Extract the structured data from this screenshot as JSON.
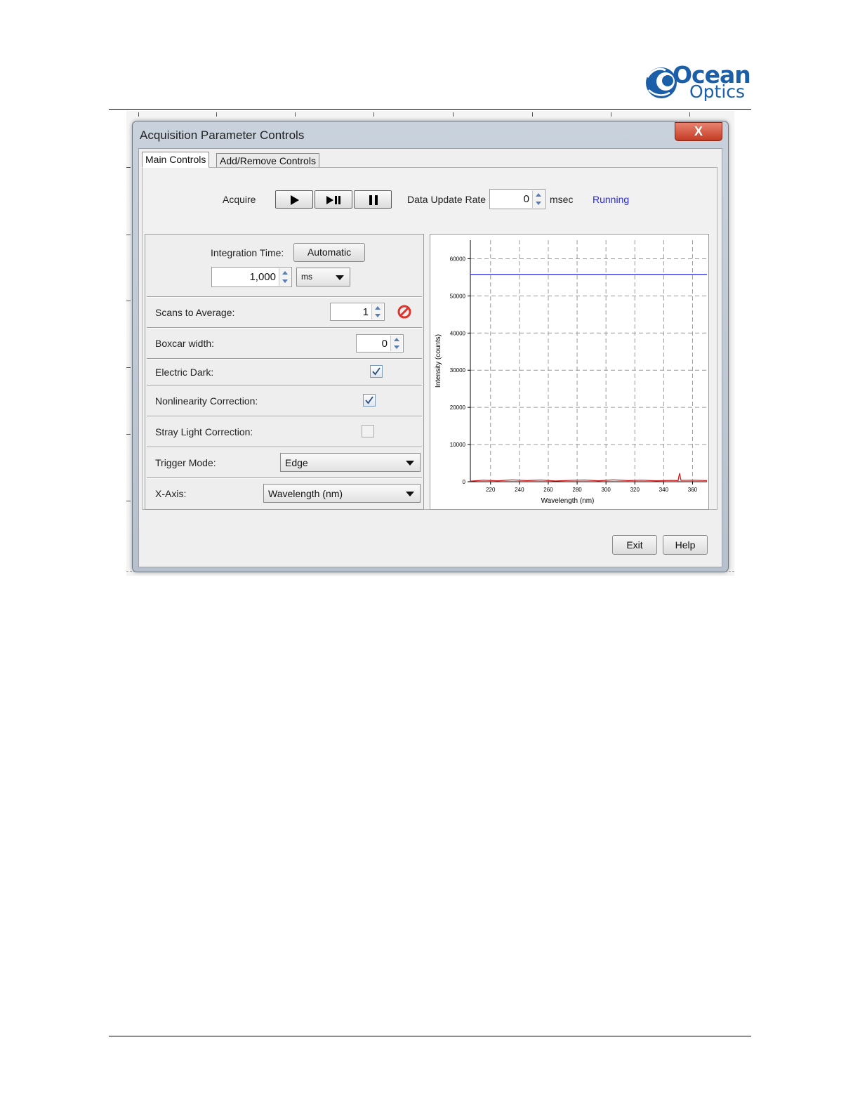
{
  "brand": {
    "line1": "Ocean",
    "line2": "Optics"
  },
  "window": {
    "title": "Acquisition Parameter Controls",
    "close_glyph": "X"
  },
  "tabs": [
    {
      "label": "Main Controls",
      "active": true
    },
    {
      "label": "Add/Remove Controls",
      "active": false
    }
  ],
  "acquire": {
    "label": "Acquire",
    "buttons": [
      "play-icon",
      "play-pause-icon",
      "pause-icon"
    ],
    "data_update_rate_label": "Data Update Rate",
    "data_update_rate_value": "0",
    "unit": "msec",
    "status": "Running",
    "status_color": "#2a2ad6"
  },
  "integration": {
    "label": "Integration Time:",
    "auto_button": "Automatic",
    "value": "1,000",
    "unit_selected": "ms"
  },
  "scans": {
    "label": "Scans to Average:",
    "value": "1",
    "icon": "no-entry-icon"
  },
  "boxcar": {
    "label": "Boxcar width:",
    "value": "0"
  },
  "electric_dark": {
    "label": "Electric Dark:",
    "checked": true
  },
  "nonlinearity": {
    "label": "Nonlinearity Correction:",
    "checked": true
  },
  "stray_light": {
    "label": "Stray Light Correction:",
    "checked": false
  },
  "trigger": {
    "label": "Trigger Mode:",
    "selected": "Edge"
  },
  "xaxis": {
    "label": "X-Axis:",
    "selected": "Wavelength (nm)"
  },
  "footer": {
    "exit": "Exit",
    "help": "Help"
  },
  "chart_data": {
    "type": "line",
    "xlabel": "Wavelength (nm)",
    "ylabel": "Intensity (counts)",
    "xlim": [
      206,
      370
    ],
    "ylim": [
      0,
      65000
    ],
    "x_ticks": [
      220,
      240,
      260,
      280,
      300,
      320,
      340,
      360
    ],
    "y_ticks": [
      0,
      10000,
      20000,
      30000,
      40000,
      50000,
      60000
    ],
    "grid": true,
    "series": [
      {
        "values_x": [
          206,
          370
        ],
        "values_y": [
          55800,
          55800
        ],
        "color": "#3b3be0"
      },
      {
        "values_x": [
          206,
          215,
          225,
          235,
          245,
          255,
          265,
          275,
          285,
          295,
          305,
          315,
          325,
          335,
          345,
          350,
          351,
          352,
          360,
          370
        ],
        "values_y": [
          150,
          400,
          250,
          500,
          300,
          450,
          200,
          350,
          450,
          250,
          500,
          300,
          400,
          250,
          350,
          300,
          2300,
          350,
          400,
          300
        ],
        "color": "#d42020"
      }
    ]
  }
}
